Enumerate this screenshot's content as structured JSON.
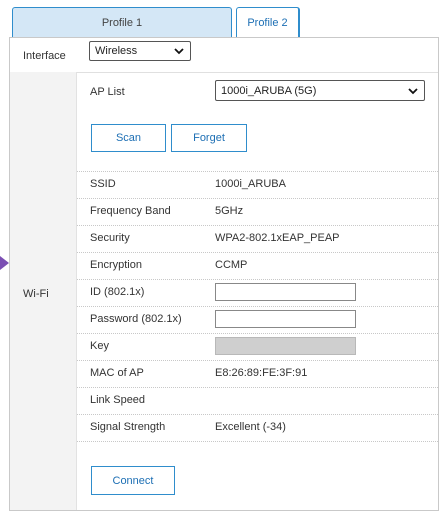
{
  "tabs": [
    {
      "label": "Profile 1"
    },
    {
      "label": "Profile 2"
    }
  ],
  "interface": {
    "label": "Interface",
    "value": "Wireless"
  },
  "section_label": "Wi-Fi",
  "ap_list": {
    "label": "AP List",
    "value": "1000i_ARUBA (5G)"
  },
  "buttons": {
    "scan": "Scan",
    "forget": "Forget",
    "connect": "Connect"
  },
  "fields": [
    {
      "label": "SSID",
      "value": "1000i_ARUBA"
    },
    {
      "label": "Frequency Band",
      "value": "5GHz"
    },
    {
      "label": "Security",
      "value": "WPA2-802.1xEAP_PEAP"
    },
    {
      "label": "Encryption",
      "value": "CCMP"
    },
    {
      "label": "ID (802.1x)",
      "value": ""
    },
    {
      "label": "Password (802.1x)",
      "value": ""
    },
    {
      "label": "Key",
      "value": ""
    },
    {
      "label": "MAC of AP",
      "value": "E8:26:89:FE:3F:91"
    },
    {
      "label": "Link Speed",
      "value": ""
    },
    {
      "label": "Signal Strength",
      "value": "Excellent (-34)"
    }
  ],
  "colors": {
    "accent": "#2f8dcc",
    "tab_active_bg": "#d4e7f6",
    "pointer": "#7b4fb3"
  }
}
